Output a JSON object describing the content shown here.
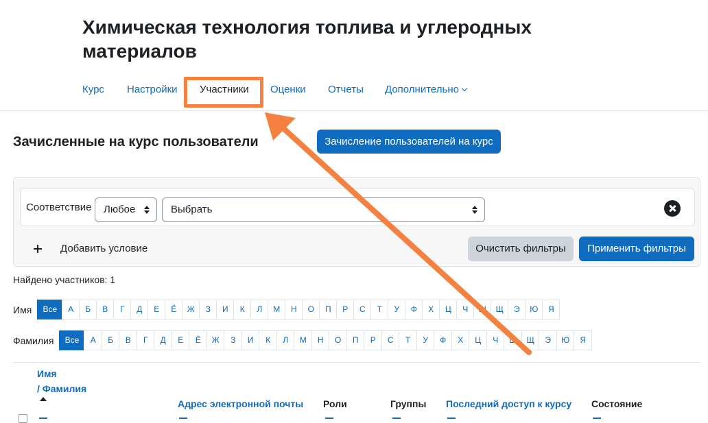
{
  "course": {
    "title": "Химическая технология топлива и углеродных материалов"
  },
  "nav": {
    "items": [
      {
        "label": "Курс"
      },
      {
        "label": "Настройки"
      },
      {
        "label": "Участники"
      },
      {
        "label": "Оценки"
      },
      {
        "label": "Отчеты"
      },
      {
        "label": "Дополнительно"
      }
    ],
    "active": "Участники"
  },
  "page": {
    "heading": "Зачисленные на курс пользователи",
    "enrol_button": "Зачисление пользователей на курс"
  },
  "filters": {
    "match_label": "Соответствие",
    "match_value": "Любое",
    "condition_value": "Выбрать",
    "add_condition": "Добавить условие",
    "clear_button": "Очистить фильтры",
    "apply_button": "Применить фильтры"
  },
  "participants": {
    "found_text": "Найдено участников: 1"
  },
  "initials": {
    "first_label": "Имя",
    "last_label": "Фамилия",
    "all_label": "Все",
    "letters": [
      "А",
      "Б",
      "В",
      "Г",
      "Д",
      "Е",
      "Ё",
      "Ж",
      "З",
      "И",
      "К",
      "Л",
      "М",
      "Н",
      "О",
      "П",
      "Р",
      "С",
      "Т",
      "У",
      "Ф",
      "Х",
      "Ц",
      "Ч",
      "Ш",
      "Щ",
      "Э",
      "Ю",
      "Я"
    ]
  },
  "table": {
    "col_firstname": "Имя",
    "col_lastname": "/ Фамилия",
    "col_email": "Адрес электронной почты",
    "col_roles": "Роли",
    "col_groups": "Группы",
    "col_lastaccess": "Последний доступ к курсу",
    "col_status": "Состояние"
  },
  "colors": {
    "accent": "#0f6cbf",
    "annotation": "#f4813f",
    "text": "#1d2125",
    "secondary_button": "#ced4da"
  }
}
